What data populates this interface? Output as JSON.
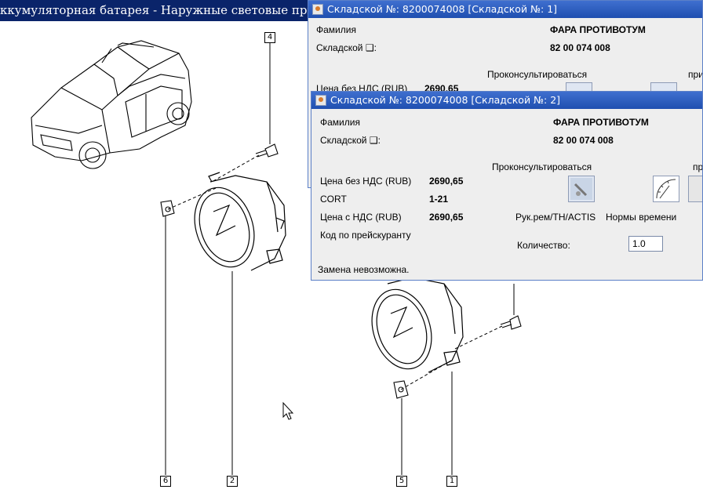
{
  "main_window": {
    "title": "ккумуляторная батарея - Наружные световые приб"
  },
  "callouts": {
    "c1": "1",
    "c2": "2",
    "c4": "4",
    "c5": "5",
    "c6": "6"
  },
  "window1": {
    "title": "Складской №: 8200074008 [Складской №: 1]",
    "family_label": "Фамилия",
    "family_value": "ФАРА ПРОТИВОТУМ",
    "sku_label": "Складской ❑:",
    "sku_value": "82 00 074 008",
    "consult_label": "Проконсультироваться",
    "price_label": "Цена без НДС (RUB)",
    "price_value": "2690,65",
    "partial_label": "при"
  },
  "window2": {
    "title": "Складской №: 8200074008 [Складской №: 2]",
    "family_label": "Фамилия",
    "family_value": "ФАРА ПРОТИВОТУМ",
    "sku_label": "Складской ❑:",
    "sku_value": "82 00 074 008",
    "price_no_vat_label": "Цена без НДС (RUB)",
    "price_no_vat_value": "2690,65",
    "cort_label": "CORT",
    "cort_value": "1-21",
    "price_vat_label": "Цена с НДС (RUB)",
    "price_vat_value": "2690,65",
    "pricelist_code_label": "Код по прейскуранту",
    "consult_label": "Проконсультироваться",
    "partial_label": "пр",
    "manual_label": "Рук.рем/TH/ACTIS",
    "time_norms_label": "Нормы времени",
    "quantity_label": "Количество:",
    "quantity_value": "1.0",
    "replacement_text": "Замена невозможна."
  },
  "icons": {
    "manual": "repair-manual-icon",
    "time": "time-gauge-icon",
    "cursor": "mouse-cursor-icon"
  }
}
